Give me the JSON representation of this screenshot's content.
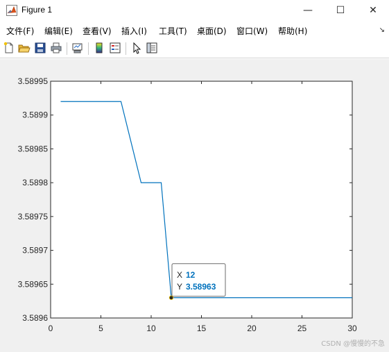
{
  "window": {
    "title": "Figure 1",
    "minimize_glyph": "—",
    "maximize_glyph": "☐",
    "close_glyph": "✕"
  },
  "menu": {
    "items": [
      "文件(F)",
      "编辑(E)",
      "查看(V)",
      "插入(I)",
      "工具(T)",
      "桌面(D)",
      "窗口(W)",
      "帮助(H)"
    ],
    "overflow_glyph": "↘"
  },
  "toolbar": {
    "icons": [
      "new-figure-icon",
      "open-file-icon",
      "save-icon",
      "print-icon",
      "link-plot-icon",
      "colorbar-icon",
      "legend-icon",
      "edit-plot-icon",
      "property-inspector-icon"
    ]
  },
  "chart_data": {
    "type": "line",
    "x": [
      1,
      2,
      3,
      4,
      5,
      6,
      7,
      8,
      9,
      10,
      11,
      12,
      13,
      14,
      15,
      16,
      17,
      18,
      19,
      20,
      21,
      22,
      23,
      24,
      25,
      26,
      27,
      28,
      29,
      30
    ],
    "series": [
      {
        "color": "#0072BD",
        "values": [
          3.58992,
          3.58992,
          3.58992,
          3.58992,
          3.58992,
          3.58992,
          3.58992,
          3.58986,
          3.5898,
          3.5898,
          3.5898,
          3.58963,
          3.58963,
          3.58963,
          3.58963,
          3.58963,
          3.58963,
          3.58963,
          3.58963,
          3.58963,
          3.58963,
          3.58963,
          3.58963,
          3.58963,
          3.58963,
          3.58963,
          3.58963,
          3.58963,
          3.58963,
          3.58963
        ]
      }
    ],
    "xlim": [
      0,
      30
    ],
    "ylim": [
      3.5896,
      3.58995
    ],
    "xticks": [
      "0",
      "5",
      "10",
      "15",
      "20",
      "25",
      "30"
    ],
    "yticks": [
      "3.5896",
      "3.58965",
      "3.5897",
      "3.58975",
      "3.5898",
      "3.58985",
      "3.5899",
      "3.58995"
    ],
    "datatip": {
      "x": 12,
      "y": 3.58963,
      "x_label": "X",
      "y_label": "Y",
      "x_text": "12",
      "y_text": "3.58963"
    },
    "grid": false
  },
  "watermark": "CSDN @慢慢的不急"
}
